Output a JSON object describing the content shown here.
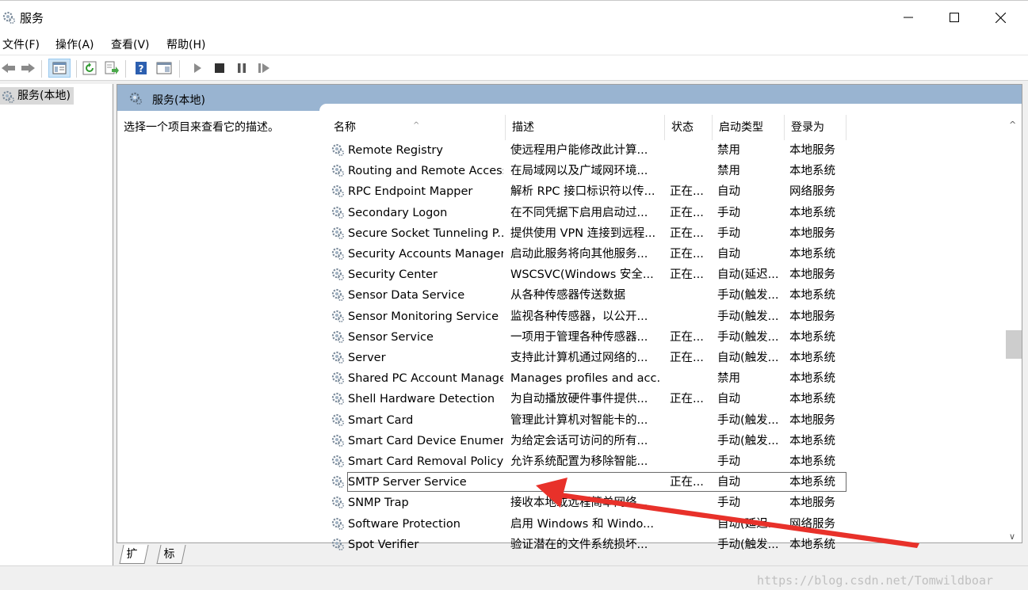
{
  "window": {
    "title": "服务",
    "minimize_glyph": "—",
    "maximize_glyph": "☐",
    "close_glyph": "✕"
  },
  "menu": [
    "文件(F)",
    "操作(A)",
    "查看(V)",
    "帮助(H)"
  ],
  "tree": {
    "root_label": "服务(本地)"
  },
  "content": {
    "header_title": "服务(本地)",
    "description_prompt": "选择一个项目来查看它的描述。"
  },
  "columns": {
    "name": "名称",
    "description": "描述",
    "status": "状态",
    "startup": "启动类型",
    "logon": "登录为"
  },
  "services": [
    {
      "name": "Remote Registry",
      "description": "使远程用户能修改此计算...",
      "status": "",
      "startup": "禁用",
      "logon": "本地服务"
    },
    {
      "name": "Routing and Remote Access",
      "description": "在局域网以及广域网环境...",
      "status": "",
      "startup": "禁用",
      "logon": "本地系统"
    },
    {
      "name": "RPC Endpoint Mapper",
      "description": "解析 RPC 接口标识符以传...",
      "status": "正在...",
      "startup": "自动",
      "logon": "网络服务"
    },
    {
      "name": "Secondary Logon",
      "description": "在不同凭据下启用启动过...",
      "status": "正在...",
      "startup": "手动",
      "logon": "本地系统"
    },
    {
      "name": "Secure Socket Tunneling P...",
      "description": "提供使用 VPN 连接到远程...",
      "status": "正在...",
      "startup": "手动",
      "logon": "本地服务"
    },
    {
      "name": "Security Accounts Manager",
      "description": "启动此服务将向其他服务...",
      "status": "正在...",
      "startup": "自动",
      "logon": "本地系统"
    },
    {
      "name": "Security Center",
      "description": "WSCSVC(Windows 安全...",
      "status": "正在...",
      "startup": "自动(延迟...",
      "logon": "本地服务"
    },
    {
      "name": "Sensor Data Service",
      "description": "从各种传感器传送数据",
      "status": "",
      "startup": "手动(触发...",
      "logon": "本地系统"
    },
    {
      "name": "Sensor Monitoring Service",
      "description": "监视各种传感器，以公开...",
      "status": "",
      "startup": "手动(触发...",
      "logon": "本地服务"
    },
    {
      "name": "Sensor Service",
      "description": "一项用于管理各种传感器...",
      "status": "正在...",
      "startup": "手动(触发...",
      "logon": "本地系统"
    },
    {
      "name": "Server",
      "description": "支持此计算机通过网络的...",
      "status": "正在...",
      "startup": "自动(触发...",
      "logon": "本地系统"
    },
    {
      "name": "Shared PC Account Manager",
      "description": "Manages profiles and acc...",
      "status": "",
      "startup": "禁用",
      "logon": "本地系统"
    },
    {
      "name": "Shell Hardware Detection",
      "description": "为自动播放硬件事件提供...",
      "status": "正在...",
      "startup": "自动",
      "logon": "本地系统"
    },
    {
      "name": "Smart Card",
      "description": "管理此计算机对智能卡的...",
      "status": "",
      "startup": "手动(触发...",
      "logon": "本地服务"
    },
    {
      "name": "Smart Card Device Enumer...",
      "description": "为给定会话可访问的所有...",
      "status": "",
      "startup": "手动(触发...",
      "logon": "本地系统"
    },
    {
      "name": "Smart Card Removal Policy",
      "description": "允许系统配置为移除智能...",
      "status": "",
      "startup": "手动",
      "logon": "本地系统"
    },
    {
      "name": "SMTP Server Service",
      "description": "",
      "status": "正在...",
      "startup": "自动",
      "logon": "本地系统",
      "selected": true
    },
    {
      "name": "SNMP Trap",
      "description": "接收本地或远程简单网络...",
      "status": "",
      "startup": "手动",
      "logon": "本地服务"
    },
    {
      "name": "Software Protection",
      "description": "启用 Windows 和 Windo...",
      "status": "",
      "startup": "自动(延迟...",
      "logon": "网络服务"
    },
    {
      "name": "Spot Verifier",
      "description": "验证潜在的文件系统损坏...",
      "status": "",
      "startup": "手动(触发...",
      "logon": "本地系统"
    }
  ],
  "tabs": [
    "扩展",
    "标准"
  ],
  "watermark": "https://blog.csdn.net/Tomwildboar",
  "colors": {
    "header_bg": "#99b4d1",
    "arrow": "#e8312a",
    "tree_selected_bg": "#d9d9d9"
  },
  "icons": {
    "toolbar": [
      "back-arrow-icon",
      "forward-arrow-icon",
      "show-hide-console-tree-icon",
      "refresh-icon",
      "export-list-icon",
      "help-icon",
      "properties-view-icon",
      "start-service-icon",
      "stop-service-icon",
      "pause-service-icon",
      "resume-service-icon"
    ],
    "service": "gear-icon"
  }
}
